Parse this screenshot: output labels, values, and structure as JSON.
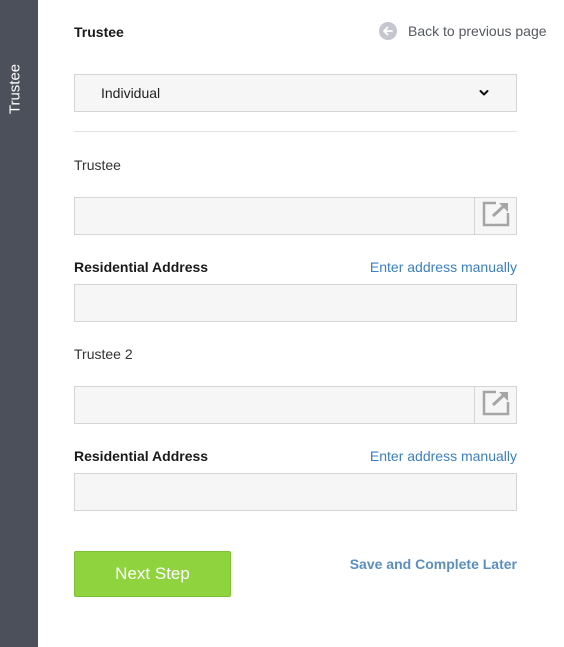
{
  "sidebar": {
    "label": "Trustee"
  },
  "header": {
    "title": "Trustee",
    "back_label": "Back to previous page"
  },
  "trustee_type": {
    "selected": "Individual"
  },
  "trustee1": {
    "label": "Trustee",
    "value": "",
    "address_label": "Residential Address",
    "manual_link": "Enter address manually",
    "address_value": ""
  },
  "trustee2": {
    "label": "Trustee 2",
    "value": "",
    "address_label": "Residential Address",
    "manual_link": "Enter address manually",
    "address_value": ""
  },
  "actions": {
    "next_label": "Next Step",
    "save_later_label": "Save and Complete Later"
  },
  "colors": {
    "sidebar": "#4b505a",
    "primary_button": "#8fd33f",
    "link": "#3a7fc4"
  }
}
